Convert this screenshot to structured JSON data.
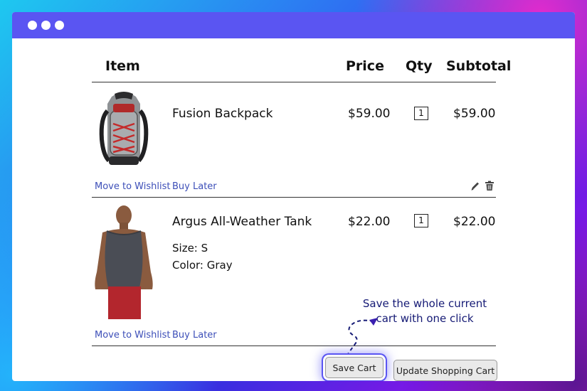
{
  "cart": {
    "headers": {
      "item": "Item",
      "price": "Price",
      "qty": "Qty",
      "subtotal": "Subtotal"
    },
    "items": [
      {
        "name": "Fusion Backpack",
        "price": "$59.00",
        "qty": "1",
        "subtotal": "$59.00",
        "options": [],
        "image_icon": "backpack-image",
        "actions": {
          "wishlist": "Move to Wishlist",
          "buy_later": "Buy Later"
        }
      },
      {
        "name": "Argus All-Weather Tank",
        "price": "$22.00",
        "qty": "1",
        "subtotal": "$22.00",
        "options": [
          "Size: S",
          "Color: Gray"
        ],
        "image_icon": "tank-top-model-image",
        "actions": {
          "wishlist": "Move to Wishlist",
          "buy_later": "Buy Later"
        }
      }
    ],
    "row_icons": [
      "pencil-icon",
      "trash-icon"
    ]
  },
  "annotation": {
    "line1": "Save the whole current",
    "line2": "cart with one click"
  },
  "buttons": {
    "save": "Save Cart",
    "update": "Update Shopping Cart"
  },
  "colors": {
    "titlebar": "#5a55f2",
    "link": "#3d4fb8",
    "annotation": "#151a75"
  }
}
